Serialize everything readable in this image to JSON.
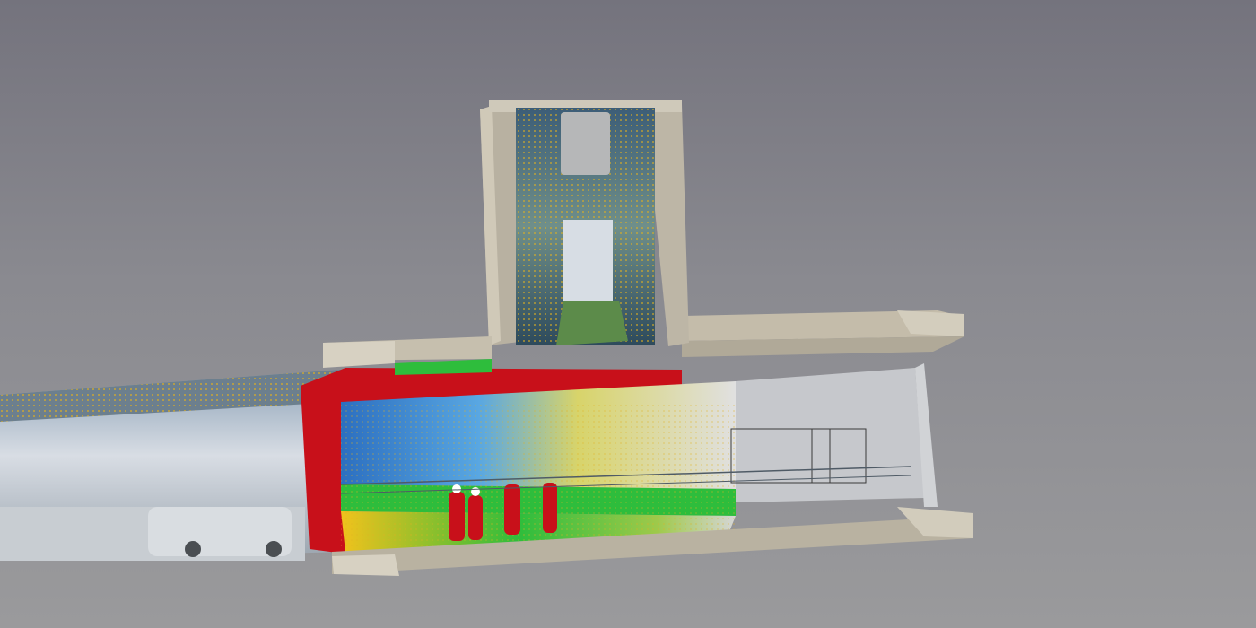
{
  "viewport": {
    "background_top": "#74737d",
    "background_bottom": "#9a9a9c"
  },
  "scene": {
    "subject": "3d-tunnel-cross-section",
    "colors": {
      "concrete_face": "#b8b1a1",
      "concrete_side": "#cfc8b6",
      "tunnel_interior": "#c6c8cc",
      "cut_section_red": "#c8101a",
      "scan_blue": "#2f7cc8",
      "scan_green": "#2ebd3c",
      "scan_yellow": "#f2c21a",
      "scan_orange": "#e58a1a",
      "scan_points": "#e0b020"
    }
  }
}
